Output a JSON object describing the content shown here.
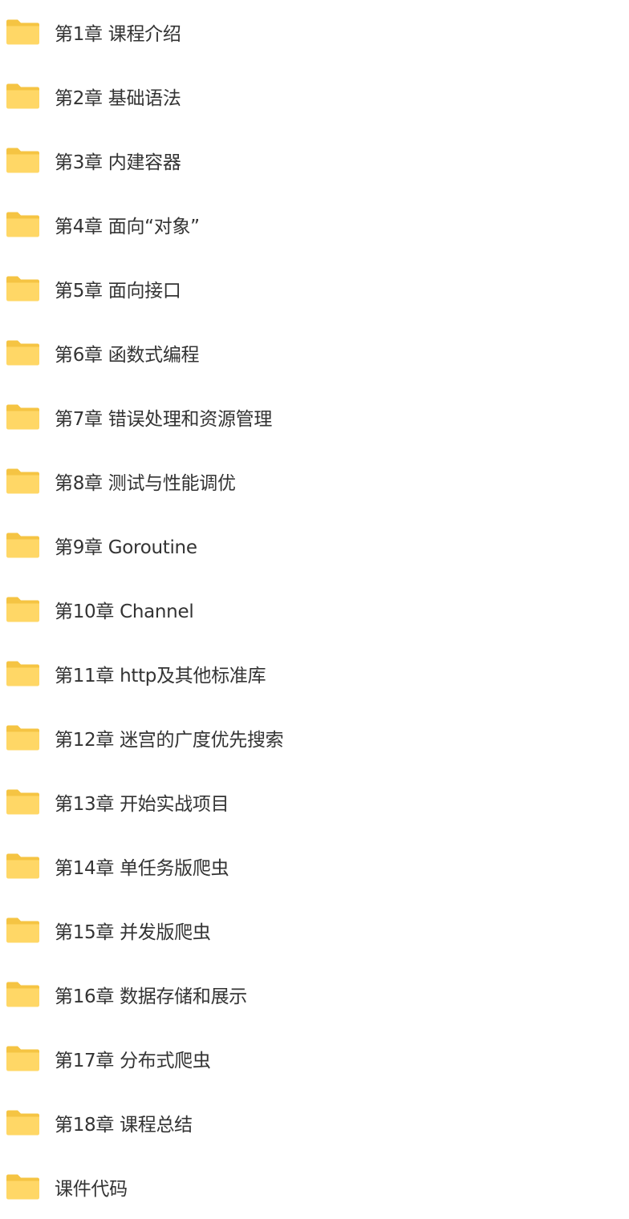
{
  "colors": {
    "folder_body": "#FFD766",
    "folder_tab": "#F5C443",
    "text": "#333333",
    "background": "#FFFFFF"
  },
  "folders": [
    {
      "icon": "folder-icon",
      "label": "第1章 课程介绍"
    },
    {
      "icon": "folder-icon",
      "label": "第2章 基础语法"
    },
    {
      "icon": "folder-icon",
      "label": "第3章 内建容器"
    },
    {
      "icon": "folder-icon",
      "label": "第4章 面向“对象”"
    },
    {
      "icon": "folder-icon",
      "label": "第5章 面向接口"
    },
    {
      "icon": "folder-icon",
      "label": "第6章 函数式编程"
    },
    {
      "icon": "folder-icon",
      "label": "第7章 错误处理和资源管理"
    },
    {
      "icon": "folder-icon",
      "label": "第8章 测试与性能调优"
    },
    {
      "icon": "folder-icon",
      "label": "第9章 Goroutine"
    },
    {
      "icon": "folder-icon",
      "label": "第10章 Channel"
    },
    {
      "icon": "folder-icon",
      "label": "第11章 http及其他标准库"
    },
    {
      "icon": "folder-icon",
      "label": "第12章 迷宫的广度优先搜索"
    },
    {
      "icon": "folder-icon",
      "label": "第13章 开始实战项目"
    },
    {
      "icon": "folder-icon",
      "label": "第14章 单任务版爬虫"
    },
    {
      "icon": "folder-icon",
      "label": "第15章 并发版爬虫"
    },
    {
      "icon": "folder-icon",
      "label": "第16章 数据存储和展示"
    },
    {
      "icon": "folder-icon",
      "label": "第17章 分布式爬虫"
    },
    {
      "icon": "folder-icon",
      "label": "第18章 课程总结"
    },
    {
      "icon": "folder-icon",
      "label": "课件代码"
    }
  ]
}
